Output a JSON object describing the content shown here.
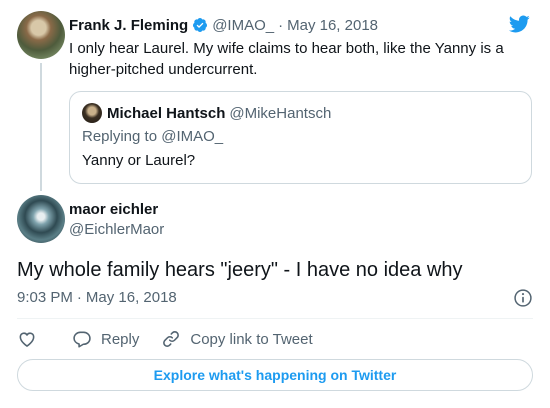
{
  "parent_tweet": {
    "author_name": "Frank J. Fleming",
    "handle": "@IMAO_",
    "date": "May 16, 2018",
    "text": "I only hear Laurel. My wife claims to hear both, like the Yanny is a higher-pitched undercurrent.",
    "verified": true
  },
  "quoted_tweet": {
    "author_name": "Michael Hantsch",
    "handle": "@MikeHantsch",
    "replying_to": "Replying to @IMAO_",
    "text": "Yanny or Laurel?"
  },
  "main_tweet": {
    "author_name": "maor eichler",
    "handle": "@EichlerMaor",
    "text": "My whole family hears \"jeery\" - I have no idea why",
    "time": "9:03 PM",
    "date": "May 16, 2018"
  },
  "actions": {
    "reply_label": "Reply",
    "copy_link_label": "Copy link to Tweet"
  },
  "explore_label": "Explore what's happening on Twitter",
  "separator": "·",
  "colors": {
    "brand": "#1d9bf0",
    "muted_text": "#536471",
    "border": "#cfd9de"
  },
  "icons": {
    "brand": "twitter-bird-icon",
    "verified": "verified-badge-icon",
    "info": "info-icon",
    "like": "heart-icon",
    "reply": "speech-bubble-icon",
    "copy_link": "link-icon"
  }
}
